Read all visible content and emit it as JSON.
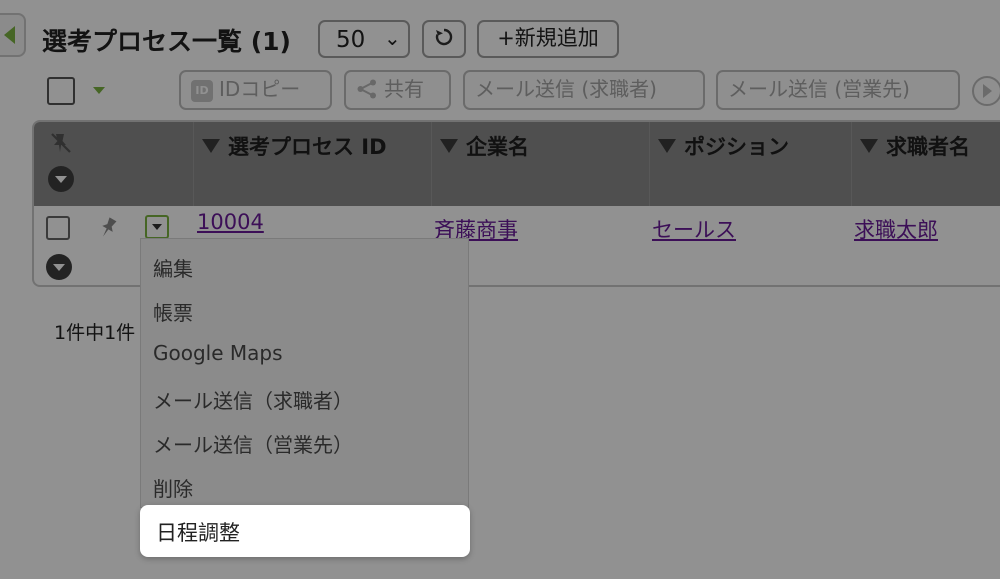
{
  "header": {
    "title": "選考プロセス一覧 (1)",
    "page_size": "50",
    "add_label": "+新規追加"
  },
  "toolbar": {
    "id_copy": "IDコピー",
    "share": "共有",
    "mail_candidate": "メール送信 (求職者)",
    "mail_sales": "メール送信 (営業先)"
  },
  "table": {
    "columns": [
      "選考プロセス ID",
      "企業名",
      "ポジション",
      "求職者名"
    ],
    "rows": [
      {
        "id": "10004",
        "company": "斉藤商事",
        "position": "セールス",
        "candidate": "求職太郎"
      }
    ]
  },
  "pager": {
    "text": "1件中1件"
  },
  "context_menu": {
    "items": [
      "編集",
      "帳票",
      "Google Maps",
      "メール送信（求職者）",
      "メール送信（営業先）",
      "削除",
      "日程調整"
    ],
    "highlighted": "日程調整"
  },
  "colors": {
    "accent": "#7cb342",
    "link": "#6a1b9a",
    "header_bg": "#8b8b8b"
  }
}
